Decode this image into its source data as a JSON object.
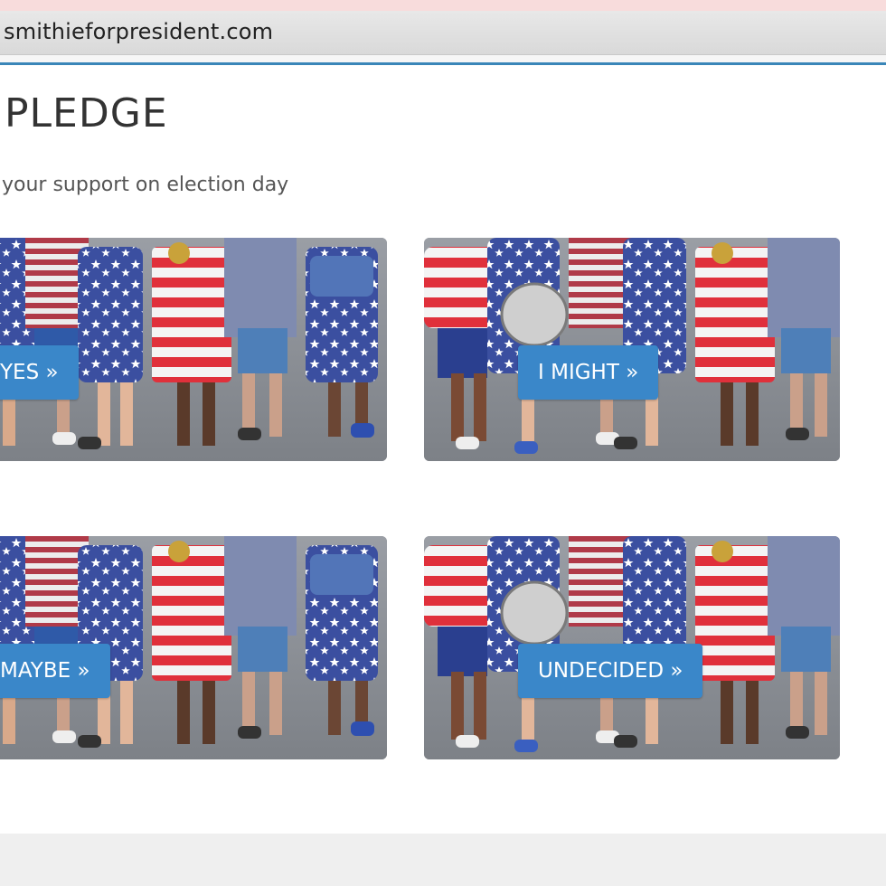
{
  "browser": {
    "url": "smithieforpresident.com"
  },
  "page": {
    "title": "PLEDGE",
    "subtitle": "your support on election day"
  },
  "cards": [
    {
      "label": "YES »"
    },
    {
      "label": "I MIGHT »"
    },
    {
      "label": "MAYBE »"
    },
    {
      "label": "UNDECIDED »"
    }
  ],
  "colors": {
    "accent": "#3a86b8",
    "button": "#3a87c9",
    "flag_red": "#e0303b",
    "flag_blue": "#3b4fa0"
  }
}
